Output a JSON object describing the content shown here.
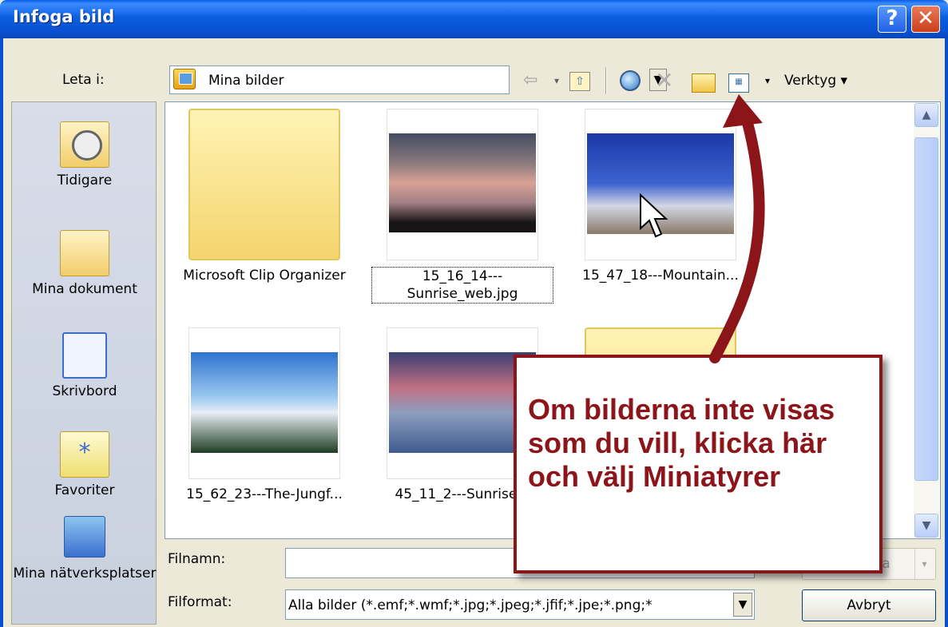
{
  "window": {
    "title": "Infoga bild",
    "help": "?",
    "close": "✕"
  },
  "toolbar": {
    "lookin_label": "Leta i:",
    "lookin_value": "Mina bilder",
    "tools_label": "Verktyg ▾",
    "dropdown_glyph": "▼",
    "small_dropdown_glyph": "▾",
    "back_glyph": "⇦",
    "delete_glyph": "✕",
    "up_glyph": "⇧",
    "views_glyph": "▦"
  },
  "places": [
    {
      "label": "Tidigare"
    },
    {
      "label": "Mina dokument"
    },
    {
      "label": "Skrivbord"
    },
    {
      "label": "Favoriter"
    },
    {
      "label": "Mina nätverksplatser"
    }
  ],
  "items": [
    {
      "name": "Microsoft Clip Organizer"
    },
    {
      "name": "15_16_14---Sunrise_web.jpg"
    },
    {
      "name": "15_47_18---Mountain..."
    },
    {
      "name": "15_62_23---The-Jungf..."
    },
    {
      "name": "45_11_2---Sunrise..."
    },
    {
      "name": ""
    }
  ],
  "scroll": {
    "up": "▲",
    "down": "▼"
  },
  "fields": {
    "filename_label": "Filnamn:",
    "filename_value": "",
    "filetype_label": "Filformat:",
    "filetype_value": "Alla bilder (*.emf;*.wmf;*.jpg;*.jpeg;*.jfif;*.jpe;*.png;*"
  },
  "buttons": {
    "insert": "Infoga",
    "cancel": "Avbryt"
  },
  "callout": {
    "text": "Om bilderna inte visas som du vill, klicka här och välj Miniatyrer"
  },
  "colors": {
    "title_bar": "#0a5ee7",
    "callout": "#8b1519",
    "dialog_bg": "#ece9d8"
  }
}
